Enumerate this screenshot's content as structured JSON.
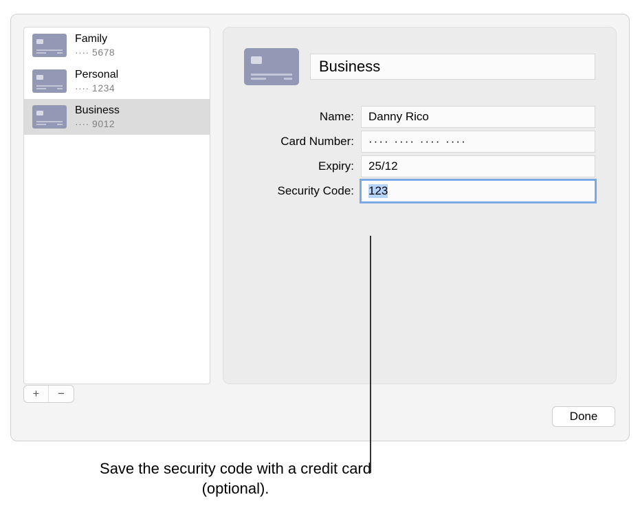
{
  "sidebar": {
    "items": [
      {
        "title": "Family",
        "digits": "···· 5678",
        "selected": false
      },
      {
        "title": "Personal",
        "digits": "···· 1234",
        "selected": false
      },
      {
        "title": "Business",
        "digits": "···· 9012",
        "selected": true
      }
    ]
  },
  "detail": {
    "card_title": "Business",
    "fields": {
      "name_label": "Name:",
      "name_value": "Danny Rico",
      "number_label": "Card Number:",
      "number_value": "···· ···· ···· ····",
      "expiry_label": "Expiry:",
      "expiry_value": "25/12",
      "security_label": "Security Code:",
      "security_value": "123"
    }
  },
  "buttons": {
    "add": "+",
    "remove": "−",
    "done": "Done"
  },
  "callout": {
    "text": "Save the security code with a credit card (optional)."
  },
  "icons": {
    "card_thumb": "credit-card-icon"
  }
}
